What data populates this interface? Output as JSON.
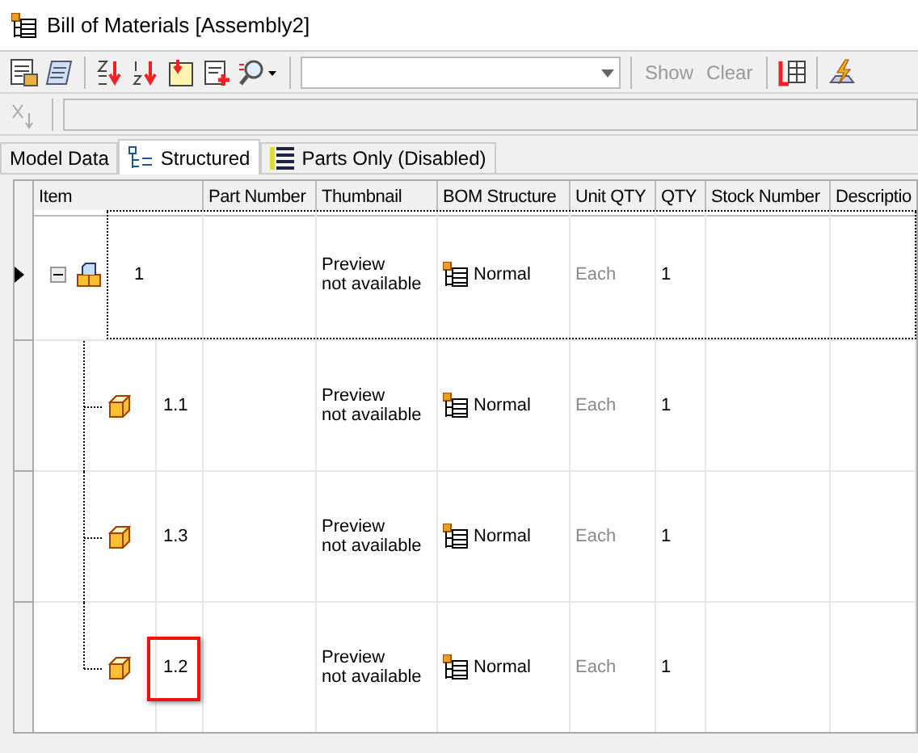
{
  "window": {
    "title": "Bill of Materials [Assembly2]"
  },
  "toolbar": {
    "buttons": [
      {
        "label": "Show",
        "disabled": true
      },
      {
        "label": "Clear",
        "disabled": true
      }
    ]
  },
  "tabs": [
    {
      "label": "Model Data",
      "selected": false
    },
    {
      "label": "Structured",
      "selected": true
    },
    {
      "label": "Parts Only (Disabled)",
      "selected": false
    }
  ],
  "table": {
    "columns": [
      "Item",
      "Part Number",
      "Thumbnail",
      "BOM Structure",
      "Unit QTY",
      "QTY",
      "Stock Number",
      "Descriptio"
    ],
    "rows": [
      {
        "item": "1",
        "kind": "assembly",
        "current": true,
        "focused": true,
        "expanded": true,
        "highlighted": false,
        "thumbnail": "Preview\nnot available",
        "bom_structure": "Normal",
        "unit_qty": "Each",
        "qty": "1",
        "children": [
          {
            "item": "1.1",
            "kind": "part",
            "current": false,
            "focused": false,
            "highlighted": false,
            "thumbnail": "Preview\nnot available",
            "bom_structure": "Normal",
            "unit_qty": "Each",
            "qty": "1"
          },
          {
            "item": "1.3",
            "kind": "part",
            "current": false,
            "focused": false,
            "highlighted": false,
            "thumbnail": "Preview\nnot available",
            "bom_structure": "Normal",
            "unit_qty": "Each",
            "qty": "1"
          },
          {
            "item": "1.2",
            "kind": "part",
            "current": false,
            "focused": false,
            "highlighted": true,
            "thumbnail": "Preview\nnot available",
            "bom_structure": "Normal",
            "unit_qty": "Each",
            "qty": "1"
          }
        ]
      }
    ]
  }
}
